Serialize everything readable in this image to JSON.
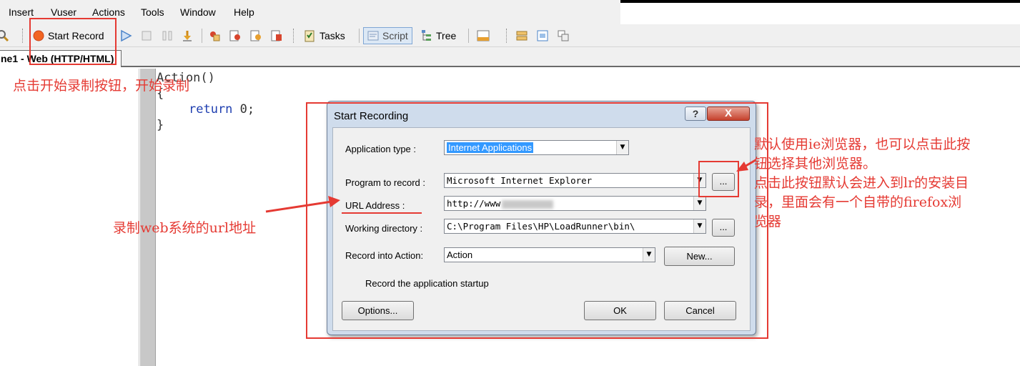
{
  "menu": [
    "Insert",
    "Vuser",
    "Actions",
    "Tools",
    "Window",
    "Help"
  ],
  "toolbar": {
    "start_record": "Start Record",
    "tasks": "Tasks",
    "script": "Script",
    "tree": "Tree"
  },
  "doc_tab": "ne1 - Web (HTTP/HTML)",
  "code": {
    "line1": "Action()",
    "line2": "{",
    "line3_kw": "return",
    "line3_rest": " 0;",
    "line4": "}"
  },
  "annotations": {
    "start_record": "点击开始录制按钮，开始录制",
    "url": "录制web系统的url地址",
    "browser_lines": [
      "默认使用ie浏览器，也可以点击此按",
      "钮选择其他浏览器。",
      "点击此按钮默认会进入到lr的安装目",
      "录，里面会有一个自带的firefox浏",
      "览器"
    ]
  },
  "dialog": {
    "title": "Start Recording",
    "help_label": "?",
    "close_label": "X",
    "application_type_label": "Application type :",
    "application_type_value": "Internet Applications",
    "program_label": "Program to record :",
    "program_value": "Microsoft Internet Explorer",
    "url_label": "URL Address :",
    "url_value": "http://www",
    "working_dir_label": "Working directory :",
    "working_dir_value": "C:\\Program Files\\HP\\LoadRunner\\bin\\",
    "record_into_label": "Record into Action:",
    "record_into_value": "Action",
    "browse_label": "...",
    "new_label": "New...",
    "record_startup_label": "Record the application startup",
    "record_startup_checked": true,
    "options_label": "Options...",
    "ok_label": "OK",
    "cancel_label": "Cancel"
  },
  "colors": {
    "annotation": "#e53a33",
    "selection": "#3399ff",
    "keyword": "#1f3fb0"
  }
}
